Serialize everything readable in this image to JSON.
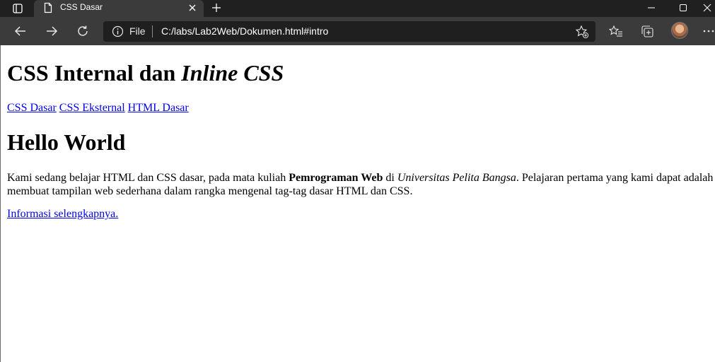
{
  "browser": {
    "tab": {
      "title": "CSS Dasar"
    },
    "addressbar": {
      "scheme_label": "File",
      "url": "C:/labs/Lab2Web/Dokumen.html#intro"
    }
  },
  "page": {
    "heading_main": {
      "part1": "CSS Internal dan ",
      "part2_italic": "Inline CSS"
    },
    "nav_links": [
      {
        "label": "CSS Dasar"
      },
      {
        "label": "CSS Eksternal"
      },
      {
        "label": "HTML Dasar"
      }
    ],
    "heading_hello": "Hello World",
    "paragraph": {
      "text1": "Kami sedang belajar HTML dan CSS dasar, pada mata kuliah ",
      "bold": "Pemrograman Web",
      "text2": " di ",
      "italic": "Universitas Pelita Bangsa",
      "text3": ". Pelajaran pertama yang kami dapat adalah membuat tampilan web sederhana dalam rangka mengenal tag-tag dasar HTML dan CSS."
    },
    "more_link": "Informasi selengkapnya."
  }
}
